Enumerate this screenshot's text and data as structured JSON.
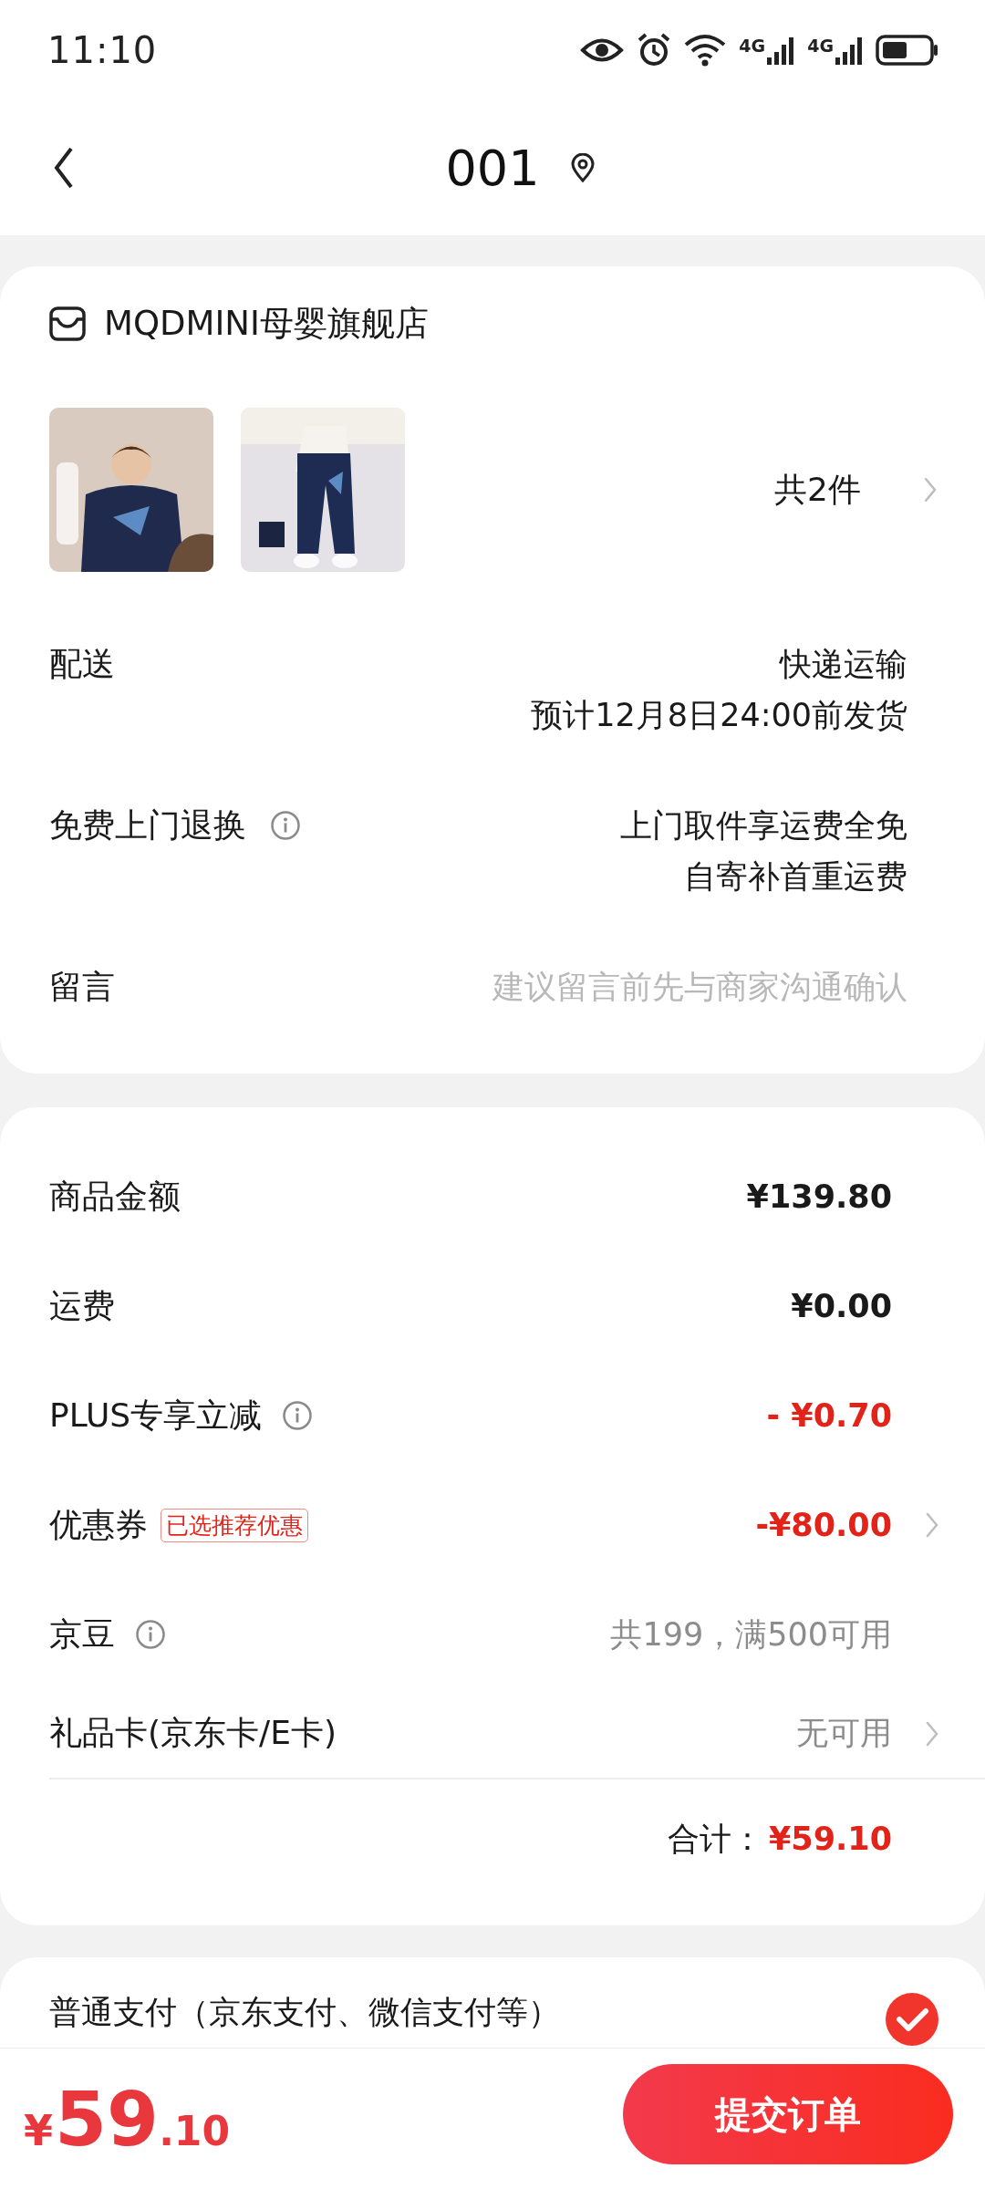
{
  "status_bar": {
    "time": "11:10",
    "networks": [
      "4G",
      "4G"
    ]
  },
  "header": {
    "title": "001"
  },
  "store": {
    "name": "MQDMINI母婴旗舰店",
    "count": "共2件"
  },
  "details": [
    {
      "kind": "text",
      "label": "配送",
      "info": false,
      "lines": [
        "快递运输",
        "预计12月8日24:00前发货"
      ]
    },
    {
      "kind": "text",
      "label": "免费上门退换",
      "info": true,
      "lines": [
        "上门取件享运费全免",
        "自寄补首重运费"
      ]
    },
    {
      "kind": "field",
      "label": "留言",
      "info": false,
      "placeholder": "建议留言前先与商家沟通确认"
    }
  ],
  "price_rows": [
    {
      "label": "商品金额",
      "info": false,
      "value": "¥139.80",
      "color": "#1a1a1a",
      "bold": true,
      "chevron": false
    },
    {
      "label": "运费",
      "info": false,
      "value": "¥0.00",
      "color": "#1a1a1a",
      "bold": true,
      "chevron": false
    },
    {
      "label": "PLUS专享立减",
      "info": true,
      "value": "- ¥0.70",
      "color": "#e2231a",
      "bold": true,
      "chevron": false
    },
    {
      "label": "优惠券",
      "info": false,
      "badge": "已选推荐优惠",
      "value": "-¥80.00",
      "color": "#e2231a",
      "bold": true,
      "chevron": true
    },
    {
      "label": "京豆",
      "info": true,
      "value": "共199，满500可用",
      "color": "#8c8c8c",
      "bold": false,
      "chevron": false
    },
    {
      "label": "礼品卡(京东卡/E卡)",
      "info": false,
      "value": "无可用",
      "color": "#8c8c8c",
      "bold": false,
      "chevron": true
    }
  ],
  "total": {
    "label": "合计：",
    "value": "¥59.10"
  },
  "payment": {
    "label": "普通支付（京东支付、微信支付等）",
    "selected": true
  },
  "footer": {
    "currency": "¥",
    "integer": "59",
    "decimal": ".10",
    "button": "提交订单"
  }
}
